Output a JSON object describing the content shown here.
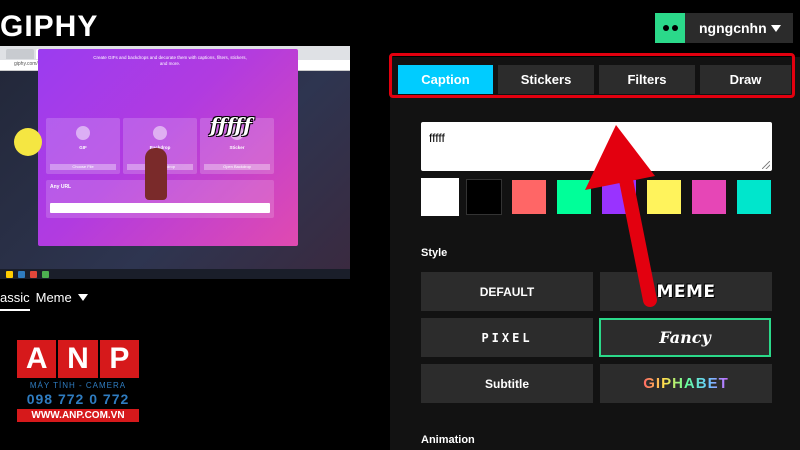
{
  "logo": "GIPHY",
  "user": {
    "name": "ngngcnhn"
  },
  "preview": {
    "address": "giphy.com/create/gifmaker",
    "card_title": "Create GIFs and backdrops and decorate them with captions, filters, stickers, and more.",
    "sub_cards": [
      {
        "title": "GIF",
        "button": "Choose File"
      },
      {
        "title": "Backdrop",
        "button": "Create Backdrop"
      },
      {
        "title": "Sticker",
        "button": "Open Backdrop"
      }
    ],
    "url_label": "Any URL",
    "sticker_text": "fffff"
  },
  "under_tabs": {
    "classic": "assic",
    "meme": "Meme"
  },
  "anp": {
    "letters": [
      "A",
      "N",
      "P"
    ],
    "line1": "MÁY TÍNH - CAMERA",
    "line2": "098 772 0 772",
    "line3": "WWW.ANP.COM.VN"
  },
  "tabs": [
    "Caption",
    "Stickers",
    "Filters",
    "Draw"
  ],
  "caption": {
    "value": "fffff"
  },
  "swatches": [
    "#ffffff",
    "#000000",
    "#ff6666",
    "#00ff99",
    "#9933ff",
    "#fff35c",
    "#e646b6",
    "#00e6cc"
  ],
  "labels": {
    "style": "Style",
    "animation": "Animation"
  },
  "styles": [
    "DEFAULT",
    "MEME",
    "PIXEL",
    "Fancy",
    "Subtitle",
    "GIPHABET"
  ],
  "colors": {
    "accent": "#00ccff",
    "highlight": "#e3000f",
    "selected": "#2bd98a"
  }
}
